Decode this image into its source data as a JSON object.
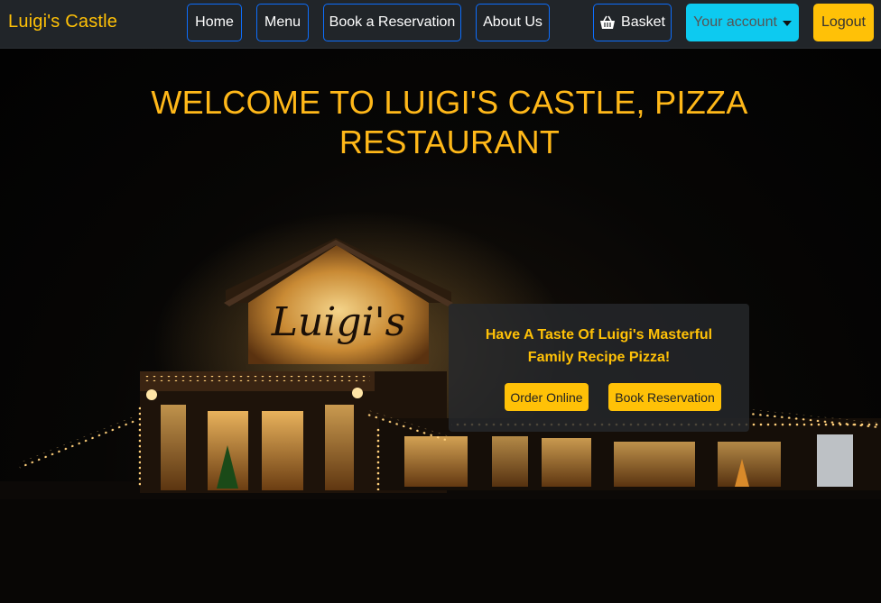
{
  "navbar": {
    "brand": "Luigi's Castle",
    "home": "Home",
    "menu": "Menu",
    "book": "Book a Reservation",
    "about": "About Us",
    "basket": "Basket",
    "account": "Your account",
    "logout": "Logout"
  },
  "hero": {
    "title": "WELCOME TO LUIGI'S CASTLE, PIZZA RESTAURANT",
    "sign_text": "Luigi's"
  },
  "promo": {
    "text": "Have A Taste Of Luigi's Masterful Family Recipe Pizza!",
    "order_online": "Order Online",
    "book_reservation": "Book Reservation"
  },
  "colors": {
    "accent": "#ffc107",
    "info": "#0dcaf0",
    "nav_border": "#0d6efd",
    "navbar_bg": "#212529"
  },
  "icons": {
    "basket": "basket-icon",
    "account_caret": "caret-down-icon"
  }
}
